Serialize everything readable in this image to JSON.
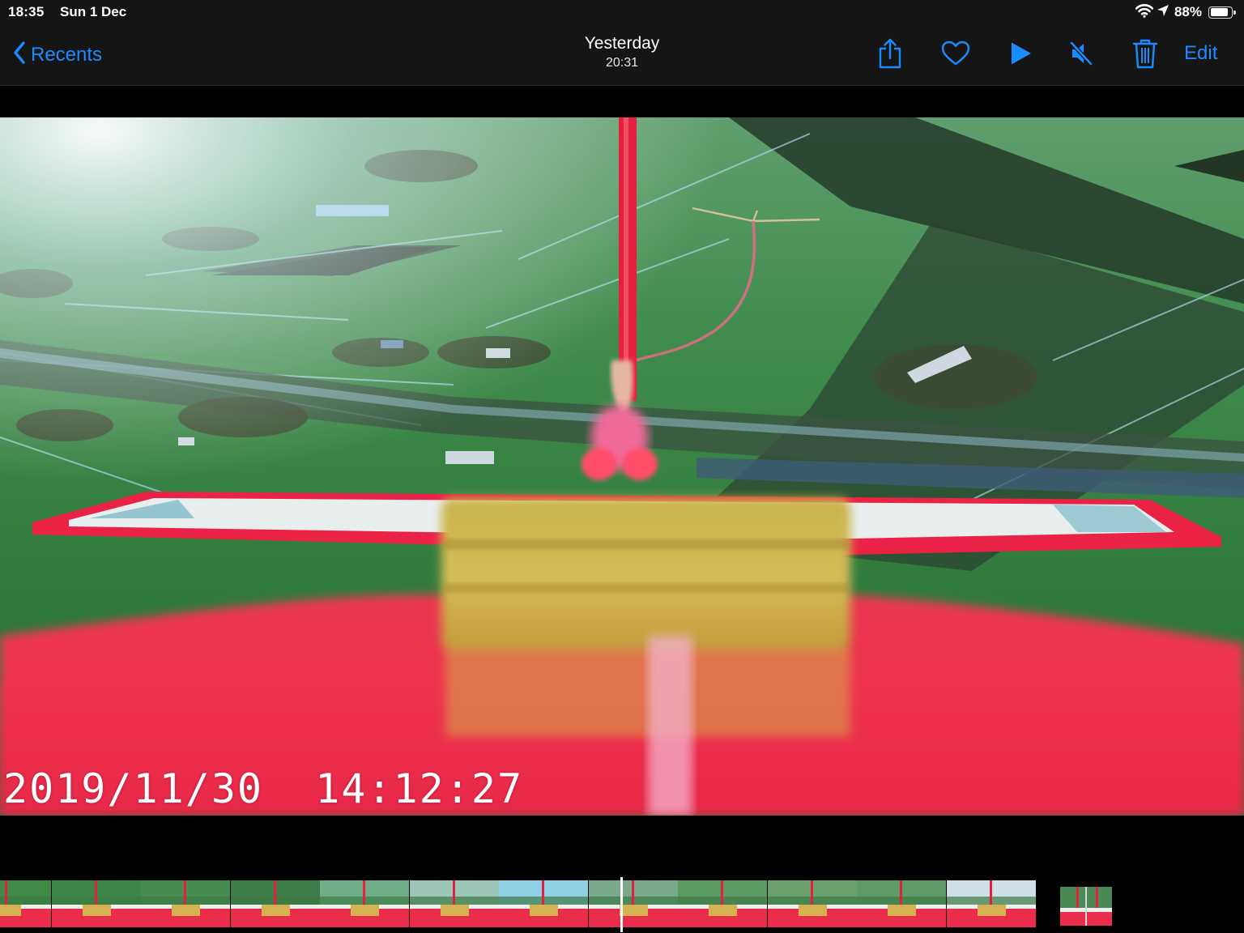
{
  "status": {
    "time": "18:35",
    "date": "Sun 1 Dec",
    "battery_percent": "88%",
    "battery_level": 0.88,
    "icons": [
      "wifi-icon",
      "location-arrow-icon",
      "battery-icon"
    ]
  },
  "nav": {
    "back_label": "Recents",
    "title": "Yesterday",
    "subtitle": "20:31",
    "edit_label": "Edit",
    "tools": [
      "share-icon",
      "heart-icon",
      "play-icon",
      "mute-icon",
      "trash-icon"
    ]
  },
  "photo": {
    "timestamp": "2019/11/30  14:12:27"
  },
  "filmstrip": {
    "thumb_count": 12
  },
  "colors": {
    "accent": "#1a8cff",
    "bar_bg": "#151515"
  }
}
